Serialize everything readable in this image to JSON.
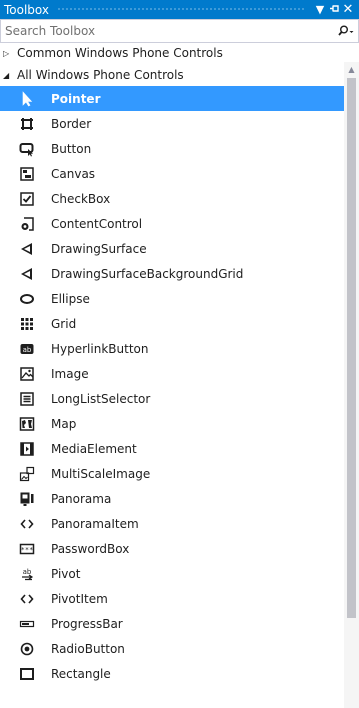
{
  "window": {
    "title": "Toolbox",
    "accent_color": "#007acc",
    "buttons": [
      "chevron-down-icon",
      "pin-icon",
      "close-icon"
    ]
  },
  "search": {
    "placeholder": "Search Toolbox",
    "value": ""
  },
  "groups": [
    {
      "label": "Common Windows Phone Controls",
      "expanded": false
    },
    {
      "label": "All Windows Phone Controls",
      "expanded": true
    }
  ],
  "items": [
    {
      "label": "Pointer",
      "icon": "pointer-icon",
      "selected": true
    },
    {
      "label": "Border",
      "icon": "border-icon"
    },
    {
      "label": "Button",
      "icon": "button-icon"
    },
    {
      "label": "Canvas",
      "icon": "canvas-icon"
    },
    {
      "label": "CheckBox",
      "icon": "checkbox-icon"
    },
    {
      "label": "ContentControl",
      "icon": "contentcontrol-icon"
    },
    {
      "label": "DrawingSurface",
      "icon": "drawingsurface-icon"
    },
    {
      "label": "DrawingSurfaceBackgroundGrid",
      "icon": "drawingsurface-icon"
    },
    {
      "label": "Ellipse",
      "icon": "ellipse-icon"
    },
    {
      "label": "Grid",
      "icon": "grid-icon"
    },
    {
      "label": "HyperlinkButton",
      "icon": "hyperlinkbutton-icon"
    },
    {
      "label": "Image",
      "icon": "image-icon"
    },
    {
      "label": "LongListSelector",
      "icon": "longlistselector-icon"
    },
    {
      "label": "Map",
      "icon": "map-icon"
    },
    {
      "label": "MediaElement",
      "icon": "mediaelement-icon"
    },
    {
      "label": "MultiScaleImage",
      "icon": "multiscaleimage-icon"
    },
    {
      "label": "Panorama",
      "icon": "panorama-icon"
    },
    {
      "label": "PanoramaItem",
      "icon": "panoramaitem-icon"
    },
    {
      "label": "PasswordBox",
      "icon": "passwordbox-icon"
    },
    {
      "label": "Pivot",
      "icon": "pivot-icon"
    },
    {
      "label": "PivotItem",
      "icon": "pivotitem-icon"
    },
    {
      "label": "ProgressBar",
      "icon": "progressbar-icon"
    },
    {
      "label": "RadioButton",
      "icon": "radiobutton-icon"
    },
    {
      "label": "Rectangle",
      "icon": "rectangle-icon"
    }
  ],
  "colors": {
    "selection": "#3399ff",
    "text": "#1e1e1e",
    "icon": "#1e1e1e"
  }
}
